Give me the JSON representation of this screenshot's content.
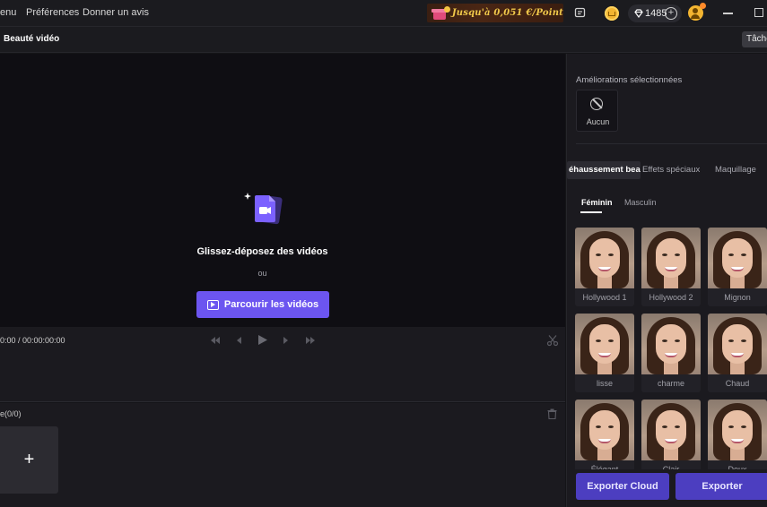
{
  "menu": {
    "items": [
      "enu",
      "Préférences",
      "Donner un avis"
    ]
  },
  "promo": {
    "label": "Jusqu'à 0,051 €/Point",
    "color": "#f0c84a"
  },
  "account": {
    "points": "1485",
    "plus": "+"
  },
  "header": {
    "title": "Beauté vidéo",
    "tasks_label": "Tâche"
  },
  "preview": {
    "drop_title": "Glissez-déposez des vidéos",
    "or_label": "ou",
    "browse_label": "Parcourir les vidéos",
    "accent": "#6c55f0"
  },
  "player": {
    "timecode": "0:00 / 00:00:00:00"
  },
  "timeline": {
    "count_label": "e(0/0)",
    "add_label": "+"
  },
  "panel": {
    "selected_label": "Améliorations sélectionnées",
    "none_label": "Aucun",
    "tabs": [
      "éhaussement beauté",
      "Effets spéciaux",
      "Maquillage"
    ],
    "subtabs": [
      "Féminin",
      "Masculin"
    ],
    "presets": [
      "Hollywood 1",
      "Hollywood 2",
      "Mignon",
      "lisse",
      "charme",
      "Chaud",
      "Élégant",
      "Clair",
      "Doux"
    ],
    "export_cloud_label": "Exporter Cloud",
    "export_label": "Exporter",
    "button_color": "#4c3ec0"
  }
}
